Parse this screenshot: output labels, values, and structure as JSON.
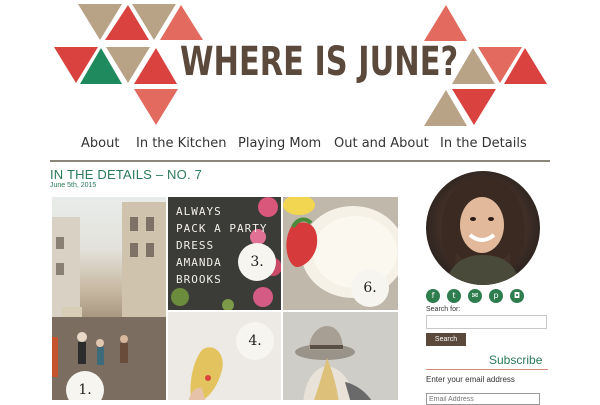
{
  "site": {
    "title": "WHERE IS JUNE?"
  },
  "colors": {
    "coral": "#e36a5e",
    "red": "#d9423f",
    "green": "#1e8a5e",
    "tan": "#b8a386",
    "brown": "#5b4a3c",
    "accent_green": "#2b7a5a"
  },
  "nav": {
    "items": [
      {
        "label": "About"
      },
      {
        "label": "In the Kitchen"
      },
      {
        "label": "Playing Mom"
      },
      {
        "label": "Out and About"
      },
      {
        "label": "In the Details"
      }
    ]
  },
  "post": {
    "title": "IN THE DETAILS – NO. 7",
    "date": "June 5th, 2015",
    "book_lines": [
      "ALWAYS",
      "PACK A PARTY",
      "DRESS",
      "AMANDA",
      "BROOKS"
    ],
    "numbers": {
      "street": "1.",
      "book": "3.",
      "yogurt": "6.",
      "cookie": "4."
    }
  },
  "sidebar": {
    "social_icons": [
      "facebook-icon",
      "twitter-icon",
      "email-icon",
      "pinterest-icon",
      "instagram-icon"
    ],
    "search_label": "Search for:",
    "search_value": "",
    "search_button": "Search",
    "subscribe_title": "Subscribe",
    "email_label": "Enter your email address",
    "email_placeholder": "Email Address"
  }
}
